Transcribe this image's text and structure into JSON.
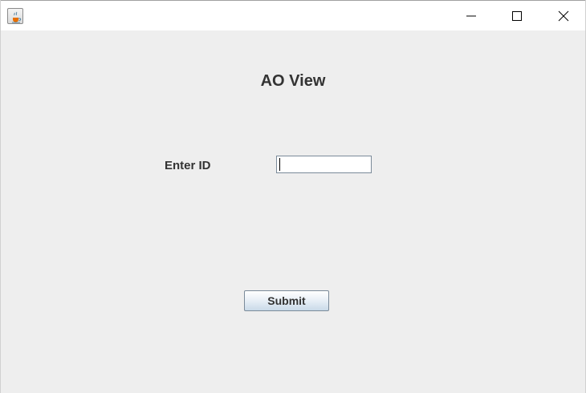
{
  "window": {
    "app_icon": "java-coffee-cup-icon",
    "controls": {
      "minimize_icon": "minimize-icon",
      "maximize_icon": "maximize-icon",
      "close_icon": "close-icon"
    }
  },
  "form": {
    "title": "AO View",
    "id_label": "Enter ID",
    "id_value": "",
    "id_placeholder": "",
    "submit_label": "Submit"
  },
  "colors": {
    "content_bg": "#eeeeee",
    "text": "#333333",
    "button_gradient_bottom": "#c9d9e8"
  }
}
